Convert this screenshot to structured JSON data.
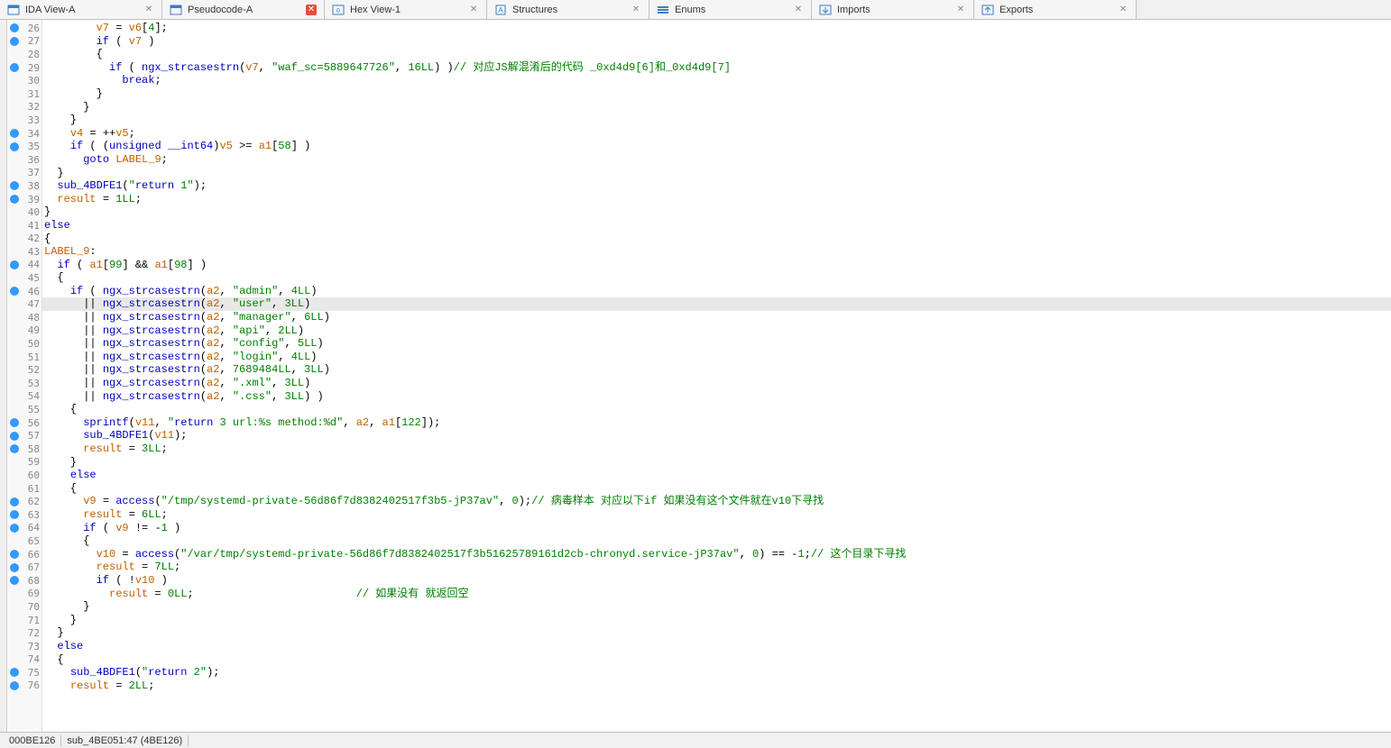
{
  "tabs": [
    {
      "label": "IDA View-A",
      "icon": "view",
      "active": false,
      "close": true
    },
    {
      "label": "Pseudocode-A",
      "icon": "code",
      "active": true,
      "close": true
    },
    {
      "label": "Hex View-1",
      "icon": "hex",
      "active": false,
      "close": true
    },
    {
      "label": "Structures",
      "icon": "struct",
      "active": false,
      "close": true
    },
    {
      "label": "Enums",
      "icon": "enum",
      "active": false,
      "close": true
    },
    {
      "label": "Imports",
      "icon": "import",
      "active": false,
      "close": true
    },
    {
      "label": "Exports",
      "icon": "export",
      "active": false,
      "close": true
    }
  ],
  "lines": [
    {
      "n": 26,
      "dot": true,
      "code": "        v7 = v6[4];",
      "cls": ""
    },
    {
      "n": 27,
      "dot": true,
      "code": "        if ( v7 )",
      "cls": ""
    },
    {
      "n": 28,
      "dot": false,
      "code": "        {",
      "cls": ""
    },
    {
      "n": 29,
      "dot": true,
      "code": "          if ( ngx_strcasestrn(v7, \"waf_sc=5889647726\", 16LL) )// 对应JS解混淆后的代码 _0xd4d9[6]和_0xd4d9[7]",
      "cls": ""
    },
    {
      "n": 30,
      "dot": false,
      "code": "            break;",
      "cls": ""
    },
    {
      "n": 31,
      "dot": false,
      "code": "        }",
      "cls": ""
    },
    {
      "n": 32,
      "dot": false,
      "code": "      }",
      "cls": ""
    },
    {
      "n": 33,
      "dot": false,
      "code": "    }",
      "cls": ""
    },
    {
      "n": 34,
      "dot": true,
      "code": "    v4 = ++v5;",
      "cls": ""
    },
    {
      "n": 35,
      "dot": true,
      "code": "    if ( (unsigned __int64)v5 >= a1[58] )",
      "cls": ""
    },
    {
      "n": 36,
      "dot": false,
      "code": "      goto LABEL_9;",
      "cls": ""
    },
    {
      "n": 37,
      "dot": false,
      "code": "  }",
      "cls": ""
    },
    {
      "n": 38,
      "dot": true,
      "code": "  sub_4BDFE1(\"return 1\");",
      "cls": ""
    },
    {
      "n": 39,
      "dot": true,
      "code": "  result = 1LL;",
      "cls": ""
    },
    {
      "n": 40,
      "dot": false,
      "code": "}",
      "cls": ""
    },
    {
      "n": 41,
      "dot": false,
      "code": "else",
      "cls": ""
    },
    {
      "n": 42,
      "dot": false,
      "code": "{",
      "cls": ""
    },
    {
      "n": 43,
      "dot": false,
      "code": "LABEL_9:",
      "cls": "",
      "noindent": true
    },
    {
      "n": 44,
      "dot": true,
      "code": "  if ( a1[99] && a1[98] )",
      "cls": ""
    },
    {
      "n": 45,
      "dot": false,
      "code": "  {",
      "cls": ""
    },
    {
      "n": 46,
      "dot": true,
      "code": "    if ( ngx_strcasestrn(a2, \"admin\", 4LL)",
      "cls": ""
    },
    {
      "n": 47,
      "dot": false,
      "code": "      || ngx_strcasestrn(a2, \"user\", 3LL)",
      "cls": "highlight"
    },
    {
      "n": 48,
      "dot": false,
      "code": "      || ngx_strcasestrn(a2, \"manager\", 6LL)",
      "cls": ""
    },
    {
      "n": 49,
      "dot": false,
      "code": "      || ngx_strcasestrn(a2, \"api\", 2LL)",
      "cls": ""
    },
    {
      "n": 50,
      "dot": false,
      "code": "      || ngx_strcasestrn(a2, \"config\", 5LL)",
      "cls": ""
    },
    {
      "n": 51,
      "dot": false,
      "code": "      || ngx_strcasestrn(a2, \"login\", 4LL)",
      "cls": ""
    },
    {
      "n": 52,
      "dot": false,
      "code": "      || ngx_strcasestrn(a2, 7689484LL, 3LL)",
      "cls": ""
    },
    {
      "n": 53,
      "dot": false,
      "code": "      || ngx_strcasestrn(a2, \".xml\", 3LL)",
      "cls": ""
    },
    {
      "n": 54,
      "dot": false,
      "code": "      || ngx_strcasestrn(a2, \".css\", 3LL) )",
      "cls": ""
    },
    {
      "n": 55,
      "dot": false,
      "code": "    {",
      "cls": ""
    },
    {
      "n": 56,
      "dot": true,
      "code": "      sprintf(v11, \"return 3 url:%s method:%d\", a2, a1[122]);",
      "cls": ""
    },
    {
      "n": 57,
      "dot": true,
      "code": "      sub_4BDFE1(v11);",
      "cls": ""
    },
    {
      "n": 58,
      "dot": true,
      "code": "      result = 3LL;",
      "cls": ""
    },
    {
      "n": 59,
      "dot": false,
      "code": "    }",
      "cls": ""
    },
    {
      "n": 60,
      "dot": false,
      "code": "    else",
      "cls": ""
    },
    {
      "n": 61,
      "dot": false,
      "code": "    {",
      "cls": ""
    },
    {
      "n": 62,
      "dot": true,
      "code": "      v9 = access(\"/tmp/systemd-private-56d86f7d8382402517f3b5-jP37av\", 0);// 病毒样本 对应以下if 如果没有这个文件就在v10下寻找",
      "cls": ""
    },
    {
      "n": 63,
      "dot": true,
      "code": "      result = 6LL;",
      "cls": ""
    },
    {
      "n": 64,
      "dot": true,
      "code": "      if ( v9 != -1 )",
      "cls": ""
    },
    {
      "n": 65,
      "dot": false,
      "code": "      {",
      "cls": ""
    },
    {
      "n": 66,
      "dot": true,
      "code": "        v10 = access(\"/var/tmp/systemd-private-56d86f7d8382402517f3b51625789161d2cb-chronyd.service-jP37av\", 0) == -1;// 这个目录下寻找",
      "cls": ""
    },
    {
      "n": 67,
      "dot": true,
      "code": "        result = 7LL;",
      "cls": ""
    },
    {
      "n": 68,
      "dot": true,
      "code": "        if ( !v10 )",
      "cls": ""
    },
    {
      "n": 69,
      "dot": false,
      "code": "          result = 0LL;                         // 如果没有 就返回空",
      "cls": ""
    },
    {
      "n": 70,
      "dot": false,
      "code": "      }",
      "cls": ""
    },
    {
      "n": 71,
      "dot": false,
      "code": "    }",
      "cls": ""
    },
    {
      "n": 72,
      "dot": false,
      "code": "  }",
      "cls": ""
    },
    {
      "n": 73,
      "dot": false,
      "code": "  else",
      "cls": ""
    },
    {
      "n": 74,
      "dot": false,
      "code": "  {",
      "cls": ""
    },
    {
      "n": 75,
      "dot": true,
      "code": "    sub_4BDFE1(\"return 2\");",
      "cls": ""
    },
    {
      "n": 76,
      "dot": true,
      "code": "    result = 2LL;",
      "cls": ""
    }
  ],
  "status": {
    "addr": "000BE126",
    "loc": "sub_4BE051:47 (4BE126)"
  }
}
